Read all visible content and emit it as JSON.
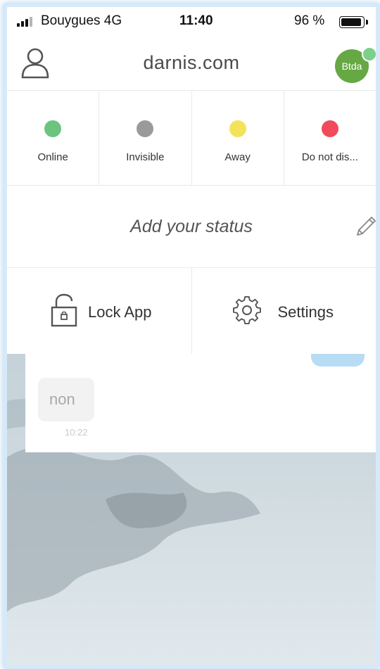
{
  "statusbar": {
    "carrier": "Bouygues 4G",
    "time": "11:40",
    "battery": "96 %"
  },
  "header": {
    "title": "darnis.com",
    "avatar_initials": "Btda",
    "avatar_color": "#66a844",
    "presence_color": "#7dd08a"
  },
  "statuses": [
    {
      "label": "Online",
      "color": "#6cc47f"
    },
    {
      "label": "Invisible",
      "color": "#9a9a9a"
    },
    {
      "label": "Away",
      "color": "#f4e25a"
    },
    {
      "label": "Do not dis...",
      "color": "#f24a5a"
    }
  ],
  "custom_status": {
    "placeholder": "Add your status"
  },
  "actions": {
    "lock_label": "Lock App",
    "settings_label": "Settings"
  },
  "chat": {
    "incoming_text": "non",
    "incoming_time": "10:22"
  },
  "icons": {
    "user": "user-icon",
    "pencil": "pencil-icon",
    "lock": "lock-icon",
    "gear": "gear-icon"
  }
}
